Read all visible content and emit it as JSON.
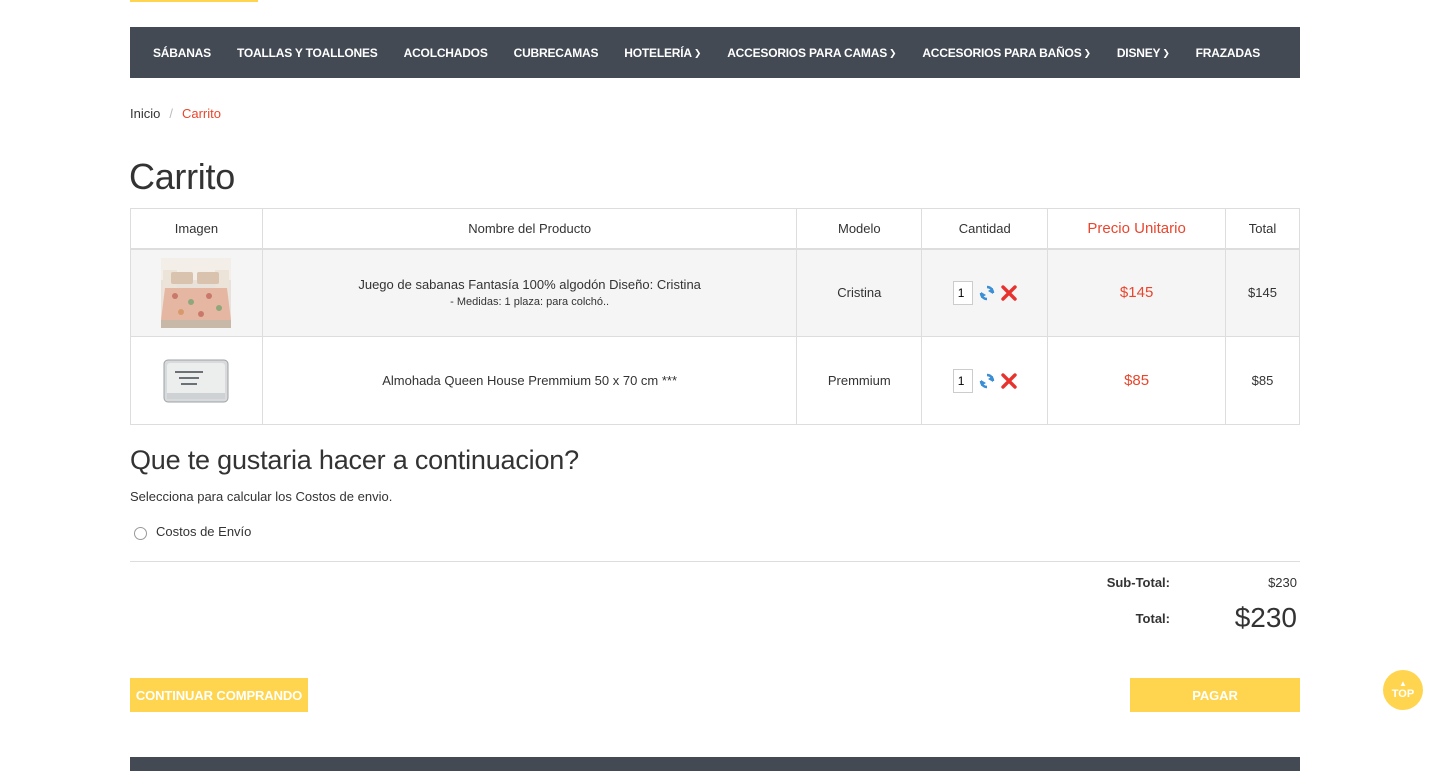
{
  "nav": {
    "items": [
      {
        "label": "SÁBANAS",
        "caret": false
      },
      {
        "label": "TOALLAS Y TOALLONES",
        "caret": false
      },
      {
        "label": "ACOLCHADOS",
        "caret": false
      },
      {
        "label": "CUBRECAMAS",
        "caret": false
      },
      {
        "label": "HOTELERÍA",
        "caret": true
      },
      {
        "label": "ACCESORIOS PARA CAMAS",
        "caret": true
      },
      {
        "label": "ACCESORIOS PARA BAÑOS",
        "caret": true
      },
      {
        "label": "DISNEY",
        "caret": true
      },
      {
        "label": "FRAZADAS",
        "caret": false
      }
    ]
  },
  "breadcrumb": {
    "home": "Inicio",
    "separator": "/",
    "current": "Carrito"
  },
  "page_title": "Carrito",
  "table": {
    "headers": {
      "image": "Imagen",
      "name": "Nombre del Producto",
      "model": "Modelo",
      "quantity": "Cantidad",
      "unit_price": "Precio Unitario",
      "total": "Total"
    },
    "rows": [
      {
        "name": "Juego de sabanas Fantasía 100% algodón Diseño: Cristina",
        "option": "- Medidas: 1 plaza: para colchó..",
        "model": "Cristina",
        "quantity": "1",
        "unit_price": "$145",
        "total": "$145",
        "image_icon": "bed-sheets-photo"
      },
      {
        "name": "Almohada Queen House Premmium 50 x 70 cm ***",
        "option": "",
        "model": "Premmium",
        "quantity": "1",
        "unit_price": "$85",
        "total": "$85",
        "image_icon": "pillow-photo"
      }
    ]
  },
  "next_steps": {
    "heading": "Que te gustaria hacer a continuacion?",
    "help_text": "Selecciona para calcular los Costos de envio.",
    "shipping_option": "Costos de Envío"
  },
  "totals": {
    "subtotal_label": "Sub-Total:",
    "subtotal_value": "$230",
    "total_label": "Total:",
    "total_value": "$230"
  },
  "buttons": {
    "continue": "CONTINUAR COMPRANDO",
    "pay": "PAGAR",
    "top": "TOP"
  },
  "colors": {
    "nav_bg": "#434a54",
    "accent_red": "#e8462d",
    "button_yellow": "#ffd54f"
  }
}
